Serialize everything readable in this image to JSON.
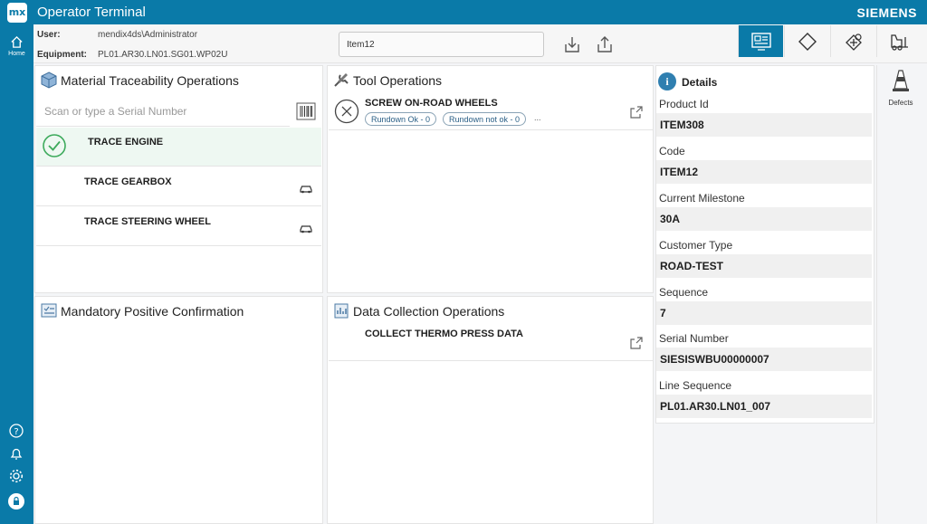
{
  "titlebar": {
    "logo": "mx",
    "title": "Operator Terminal",
    "brand": "SIEMENS"
  },
  "nav": {
    "home_label": "Home",
    "icons": [
      "home-icon",
      "help-icon",
      "bell-icon",
      "gear-icon",
      "user-avatar-icon"
    ]
  },
  "info": {
    "user_label": "User:",
    "user_value": "mendix4ds\\Administrator",
    "equipment_label": "Equipment:",
    "equipment_value": "PL01.AR30.LN01.SG01.WP02U",
    "item_value": "Item12"
  },
  "toolbar": {
    "buttons": [
      "operations-icon",
      "diamond-icon",
      "inspection-icon",
      "forklift-icon"
    ]
  },
  "material": {
    "title": "Material Traceability Operations",
    "scan_placeholder": "Scan or type a Serial Number",
    "items": [
      {
        "label": "TRACE ENGINE",
        "done": true
      },
      {
        "label": "TRACE GEARBOX",
        "done": false
      },
      {
        "label": "TRACE STEERING WHEEL",
        "done": false
      }
    ]
  },
  "tool": {
    "title": "Tool Operations",
    "items": [
      {
        "label": "SCREW ON-ROAD WHEELS",
        "chip_ok": "Rundown Ok - 0",
        "chip_not_ok": "Rundown not ok - 0",
        "more": "..."
      }
    ]
  },
  "mandatory": {
    "title": "Mandatory Positive Confirmation"
  },
  "datacollection": {
    "title": "Data Collection Operations",
    "items": [
      {
        "label": "COLLECT THERMO PRESS DATA"
      }
    ]
  },
  "details": {
    "title": "Details",
    "fields": [
      {
        "label": "Product Id",
        "value": "ITEM308"
      },
      {
        "label": "Code",
        "value": "ITEM12"
      },
      {
        "label": "Current Milestone",
        "value": "30A"
      },
      {
        "label": "Customer Type",
        "value": "ROAD-TEST"
      },
      {
        "label": "Sequence",
        "value": "7"
      },
      {
        "label": "Serial Number",
        "value": "SIESISWBU00000007"
      },
      {
        "label": "Line Sequence",
        "value": "PL01.AR30.LN01_007"
      }
    ]
  },
  "right": {
    "defects_label": "Defects"
  },
  "colors": {
    "accent": "#0a7aa8",
    "ok_green": "#3daa5c",
    "chip_border": "#8aa3b5"
  }
}
